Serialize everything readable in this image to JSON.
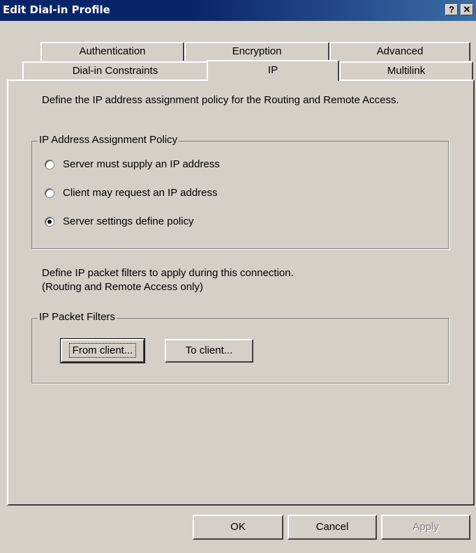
{
  "window": {
    "title": "Edit Dial-in Profile",
    "help_button": "?",
    "close_button": "✕"
  },
  "tabs": {
    "row_back": [
      {
        "label": "Authentication"
      },
      {
        "label": "Encryption"
      },
      {
        "label": "Advanced"
      }
    ],
    "row_front": [
      {
        "label": "Dial-in Constraints"
      },
      {
        "label": "IP"
      },
      {
        "label": "Multilink"
      }
    ],
    "active": "IP"
  },
  "ip_tab": {
    "intro": "Define the IP address assignment policy for the Routing and Remote Access.",
    "assignment_group": {
      "title": "IP Address Assignment Policy",
      "options": [
        {
          "label": "Server must supply an IP address",
          "selected": false
        },
        {
          "label": "Client may request an IP address",
          "selected": false
        },
        {
          "label": "Server settings define policy",
          "selected": true
        }
      ]
    },
    "filters_intro": [
      "Define IP packet filters to apply during this connection.",
      "(Routing and Remote Access only)"
    ],
    "filters_group": {
      "title": "IP Packet Filters",
      "from_client": "From client...",
      "to_client": "To client..."
    }
  },
  "footer": {
    "ok": "OK",
    "cancel": "Cancel",
    "apply": "Apply",
    "apply_enabled": false
  }
}
